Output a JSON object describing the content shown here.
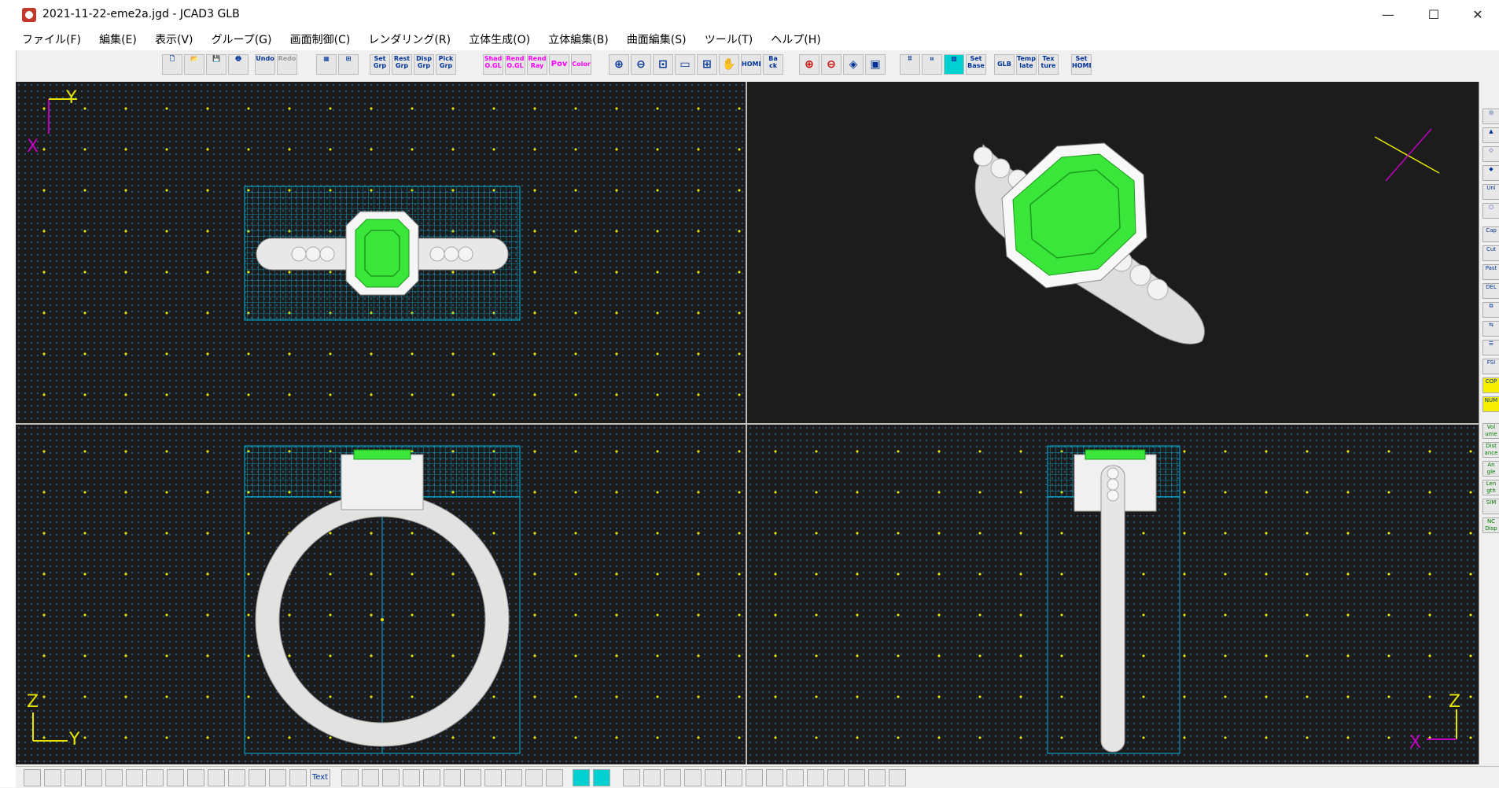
{
  "window": {
    "title": "2021-11-22-eme2a.jgd - JCAD3 GLB",
    "minimize": "—",
    "maximize": "☐",
    "close": "✕"
  },
  "menu": [
    "ファイル(F)",
    "編集(E)",
    "表示(V)",
    "グループ(G)",
    "画面制御(C)",
    "レンダリング(R)",
    "立体生成(O)",
    "立体編集(B)",
    "曲面編集(S)",
    "ツール(T)",
    "ヘルプ(H)"
  ],
  "toolbar": {
    "undo": "Undo",
    "redo": "Redo",
    "set_grp": "Set Grp",
    "reset_grp": "Rest Grp",
    "disp_grp": "Disp Grp",
    "pick_grp": "Pick Grp",
    "shad": "Shad O.GL",
    "rend_ogl": "Rend O.GL",
    "rend_ray": "Rend Ray",
    "pov": "Pov",
    "color": "Color",
    "home": "HOME",
    "back": "Ba ck",
    "set_base": "Set Base",
    "glb": "GLB",
    "template": "Temp late",
    "texture": "Tex ture",
    "set_home": "Set HOME"
  },
  "viewports": {
    "top": {
      "axis_v": "X",
      "axis_h": "Y"
    },
    "front": {
      "axis_v": "Z",
      "axis_h": "Y"
    },
    "side": {
      "axis_v": "Z",
      "axis_h": "X"
    }
  },
  "rightbar": [
    "Uni",
    "Cap",
    "Cut",
    "Past",
    "DEL",
    "FSI",
    "COP",
    "NUM",
    "Vol ume",
    "Dist ance",
    "An gle",
    "Len gth",
    "SIM",
    "NC Disp"
  ],
  "bottombar": {
    "text_label": "Text"
  },
  "colors": {
    "accent_cyan": "#00b4d8",
    "stone_green": "#39e639",
    "grid_yellow": "#e6e600",
    "viewport_bg": "#1c1c1c"
  }
}
